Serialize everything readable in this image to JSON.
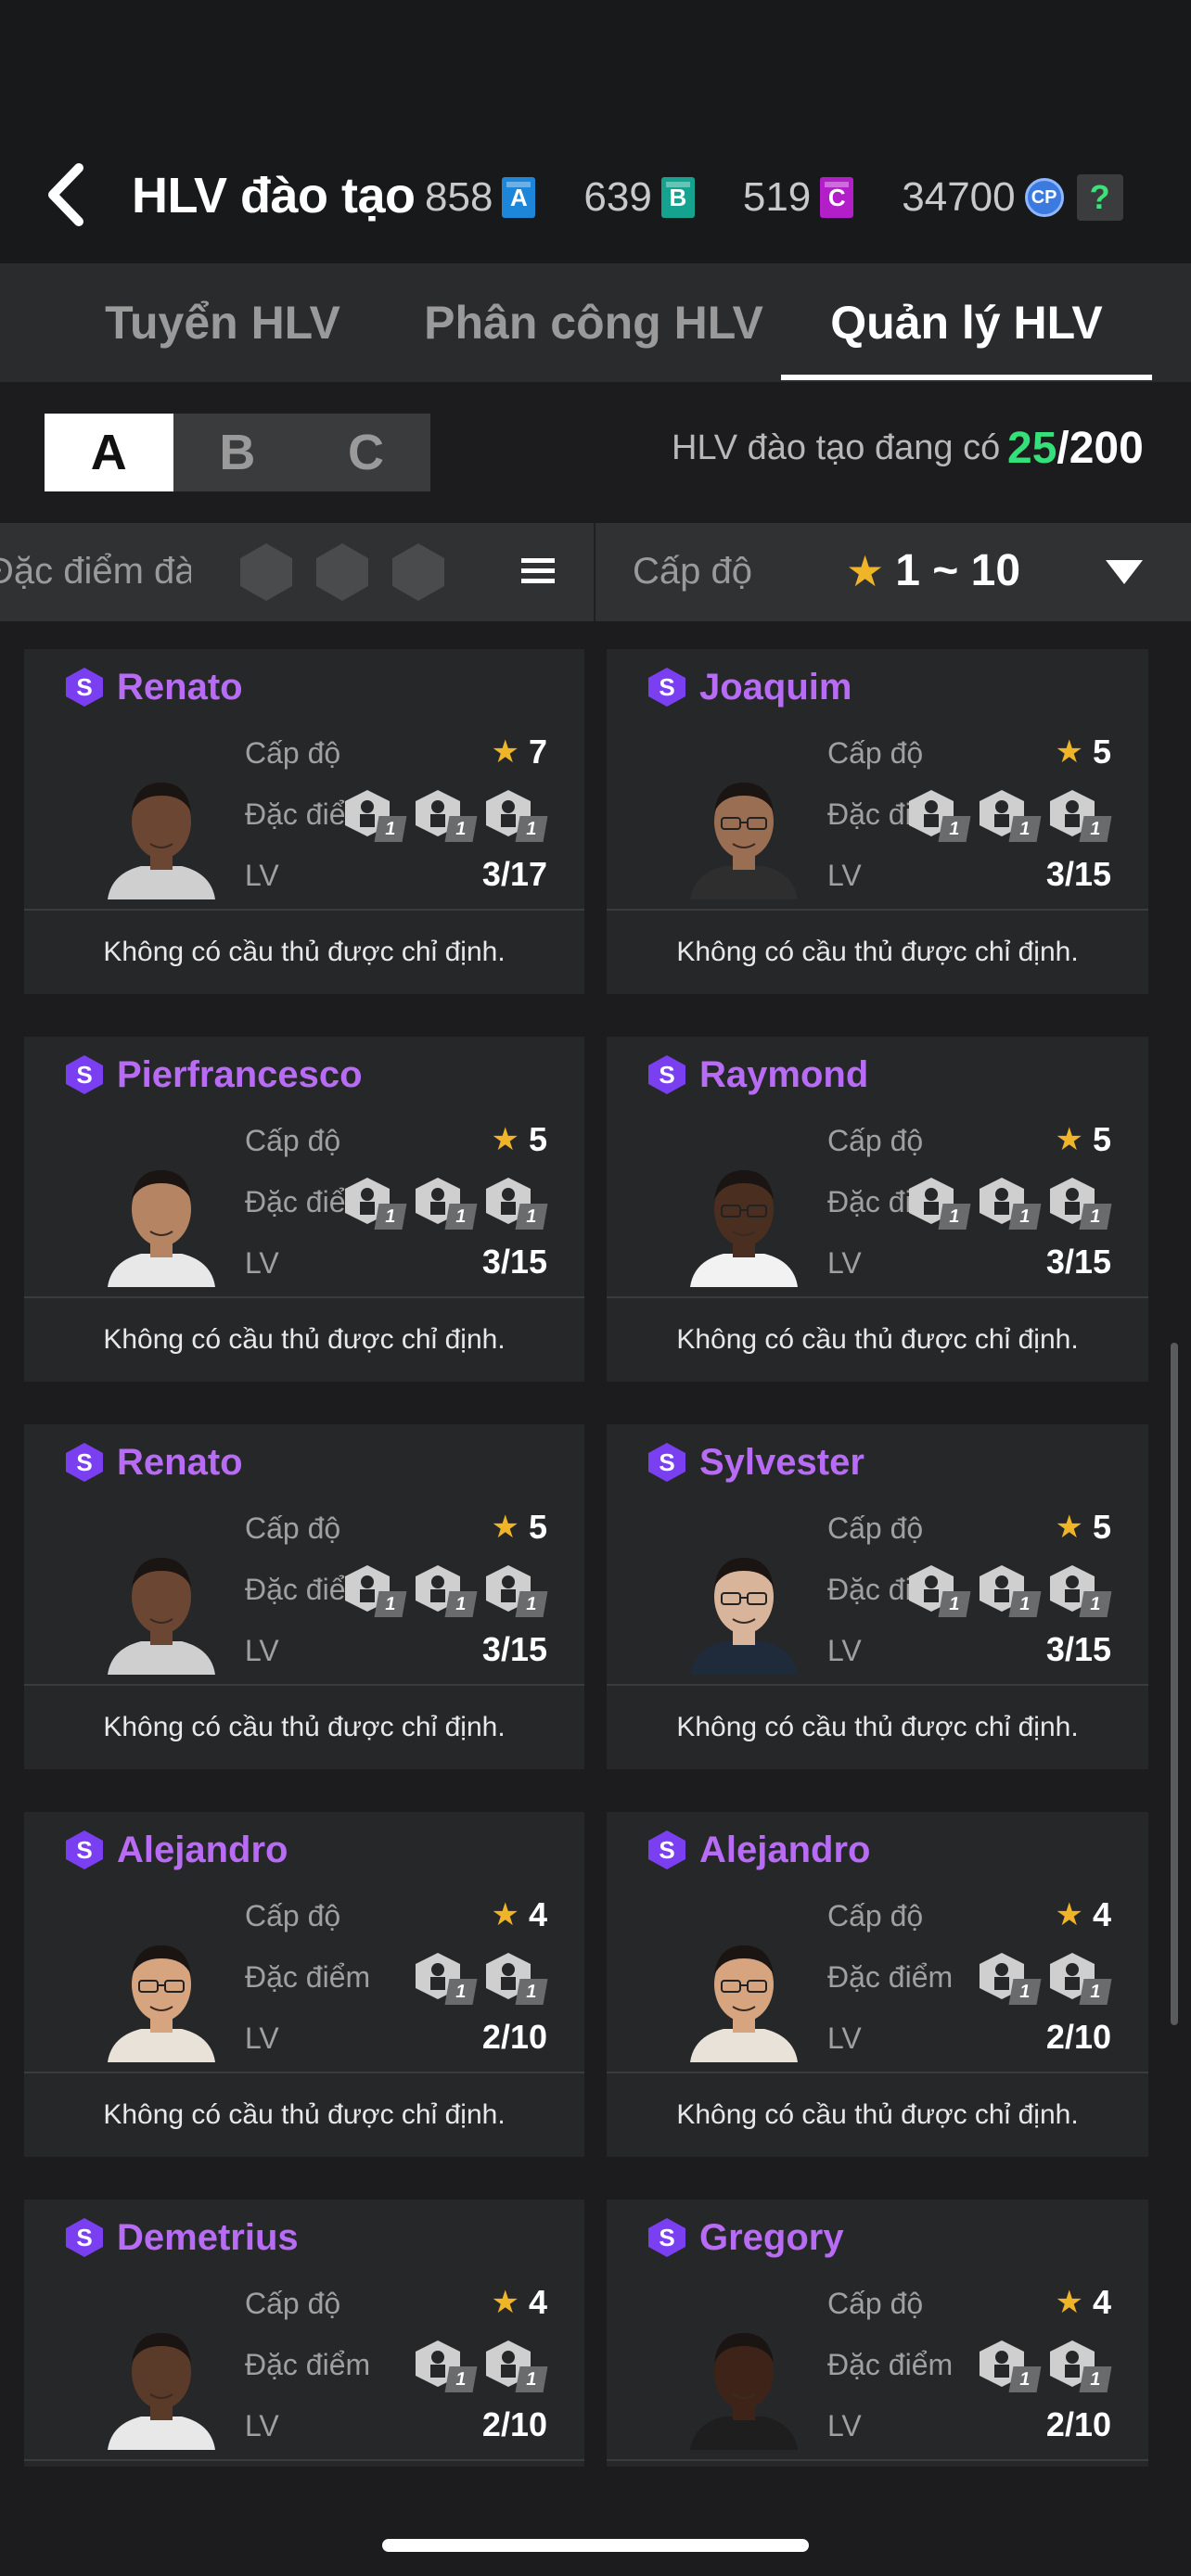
{
  "header": {
    "title": "HLV đào tạo",
    "currencies": [
      {
        "value": "858",
        "icon": "A",
        "name": "ticket-a",
        "color": "#1e86d8"
      },
      {
        "value": "639",
        "icon": "B",
        "name": "ticket-b",
        "color": "#15a38f"
      },
      {
        "value": "519",
        "icon": "C",
        "name": "ticket-c",
        "color": "#b21fc8"
      },
      {
        "value": "34700",
        "icon": "CP",
        "name": "cp-coin",
        "color": "#3d7ae0"
      }
    ],
    "help": "?"
  },
  "tabs": [
    {
      "label": "Tuyển HLV",
      "active": false
    },
    {
      "label": "Phân công HLV",
      "active": false
    },
    {
      "label": "Quản lý HLV",
      "active": true
    }
  ],
  "segment": {
    "options": [
      "A",
      "B",
      "C"
    ],
    "selected": "A"
  },
  "coach_count": {
    "label": "HLV đào tạo đang có",
    "current": "25",
    "max": "/200"
  },
  "filter": {
    "trait_label": "Đặc điểm đào",
    "level_label": "Cấp độ",
    "level_range": "1 ~ 10"
  },
  "labels": {
    "level": "Cấp độ",
    "traits": "Đặc điểm",
    "lv": "LV",
    "no_player": "Không có cầu thủ được chỉ định."
  },
  "coaches": [
    {
      "name": "Renato",
      "stars": "7",
      "lv": "3/17",
      "traits": [
        "1",
        "1",
        "1"
      ],
      "skin": "#6b4632",
      "shirt": "#cfcfcf",
      "glasses": false
    },
    {
      "name": "Joaquim",
      "stars": "5",
      "lv": "3/15",
      "traits": [
        "1",
        "1",
        "1"
      ],
      "skin": "#9a6e52",
      "shirt": "#2e2e2e",
      "glasses": true
    },
    {
      "name": "Pierfrancesco",
      "stars": "5",
      "lv": "3/15",
      "traits": [
        "1",
        "1",
        "1"
      ],
      "skin": "#b48463",
      "shirt": "#e8e8e8",
      "glasses": false
    },
    {
      "name": "Raymond",
      "stars": "5",
      "lv": "3/15",
      "traits": [
        "1",
        "1",
        "1"
      ],
      "skin": "#4a2e20",
      "shirt": "#f2f2f2",
      "glasses": true
    },
    {
      "name": "Renato",
      "stars": "5",
      "lv": "3/15",
      "traits": [
        "1",
        "1",
        "1"
      ],
      "skin": "#6b4632",
      "shirt": "#cfcfcf",
      "glasses": false
    },
    {
      "name": "Sylvester",
      "stars": "5",
      "lv": "3/15",
      "traits": [
        "1",
        "1",
        "1"
      ],
      "skin": "#d8b49a",
      "shirt": "#1f2a3a",
      "glasses": true
    },
    {
      "name": "Alejandro",
      "stars": "4",
      "lv": "2/10",
      "traits": [
        "1",
        "1"
      ],
      "skin": "#d6a47f",
      "shirt": "#e8e2d8",
      "glasses": true
    },
    {
      "name": "Alejandro",
      "stars": "4",
      "lv": "2/10",
      "traits": [
        "1",
        "1"
      ],
      "skin": "#d6a47f",
      "shirt": "#e8e2d8",
      "glasses": true
    },
    {
      "name": "Demetrius",
      "stars": "4",
      "lv": "2/10",
      "traits": [
        "1",
        "1"
      ],
      "skin": "#5a3a28",
      "shirt": "#e8e8e8",
      "glasses": false
    },
    {
      "name": "Gregory",
      "stars": "4",
      "lv": "2/10",
      "traits": [
        "1",
        "1"
      ],
      "skin": "#3e2418",
      "shirt": "#1e1e1e",
      "glasses": false
    }
  ]
}
